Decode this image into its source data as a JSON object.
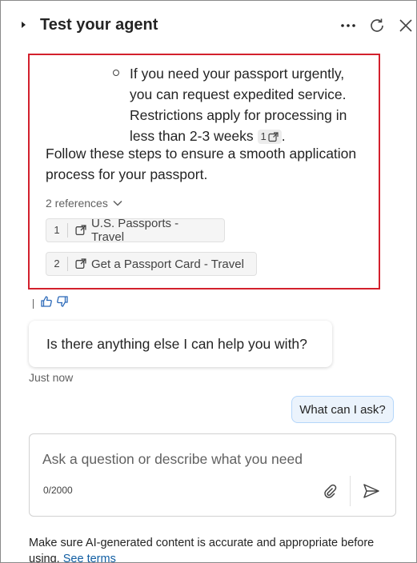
{
  "header": {
    "title": "Test your agent",
    "more_icon": "more-horizontal-icon",
    "refresh_icon": "refresh-icon",
    "close_icon": "close-icon"
  },
  "answer": {
    "bullet_text": "If you need your passport urgently, you can request expedited service. Restrictions apply for processing in less than 2-3 weeks",
    "bullet_citation": "1",
    "bullet_suffix": ".",
    "paragraph": "Follow these steps to ensure a smooth application process for your passport.",
    "references_label": "2 references",
    "references": [
      {
        "num": "1",
        "label": "U.S. Passports - Travel"
      },
      {
        "num": "2",
        "label": "Get a Passport Card - Travel"
      }
    ]
  },
  "feedback": {
    "thumbs_up_icon": "thumbs-up-icon",
    "thumbs_down_icon": "thumbs-down-icon"
  },
  "bot_message": "Is there anything else I can help you with?",
  "timestamp": "Just now",
  "user_message": "What can I ask?",
  "composer": {
    "placeholder": "Ask a question or describe what you need",
    "value": "",
    "counter": "0/2000"
  },
  "disclaimer": {
    "text": "Make sure AI-generated content is accurate and appropriate before using.",
    "link": "See terms"
  },
  "colors": {
    "highlight_border": "#d3202c",
    "link": "#115ea3",
    "user_bubble_bg": "#ebf3fc",
    "user_bubble_border": "#b4d6fa"
  }
}
